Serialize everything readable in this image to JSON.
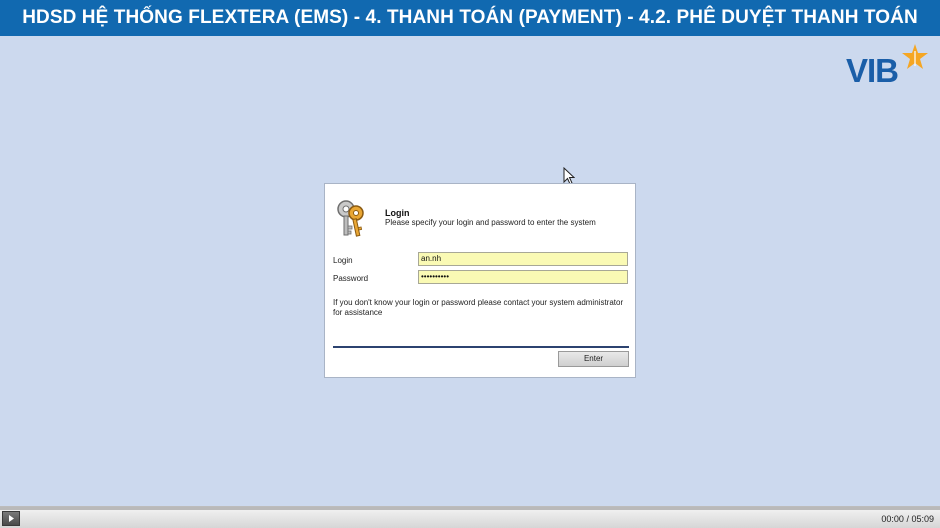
{
  "header": {
    "title": "HDSD HỆ THỐNG FLEXTERA (EMS) - 4. THANH TOÁN (PAYMENT) - 4.2. PHÊ DUYỆT THANH TOÁN"
  },
  "brand": {
    "logo_text": "VIB",
    "colors": {
      "title_bar": "#1169b0",
      "logo_blue": "#1a5ea8",
      "logo_star": "#f5a623"
    }
  },
  "stage": {
    "background": "#ccd9ee"
  },
  "login_dialog": {
    "icon": "keys-icon",
    "title": "Login",
    "subtitle": "Please specify your login and password to enter the system",
    "login_label": "Login",
    "login_value": "an.nh",
    "password_label": "Password",
    "password_value": "••••••••••",
    "help_text": "If you don't know your login or password please contact your system administrator for assistance",
    "enter_label": "Enter",
    "input_color": "#fafab4"
  },
  "player": {
    "play_icon": "play-icon",
    "time_current": "00:00",
    "time_separator": "/",
    "time_total": "05:09",
    "progress": 0
  }
}
